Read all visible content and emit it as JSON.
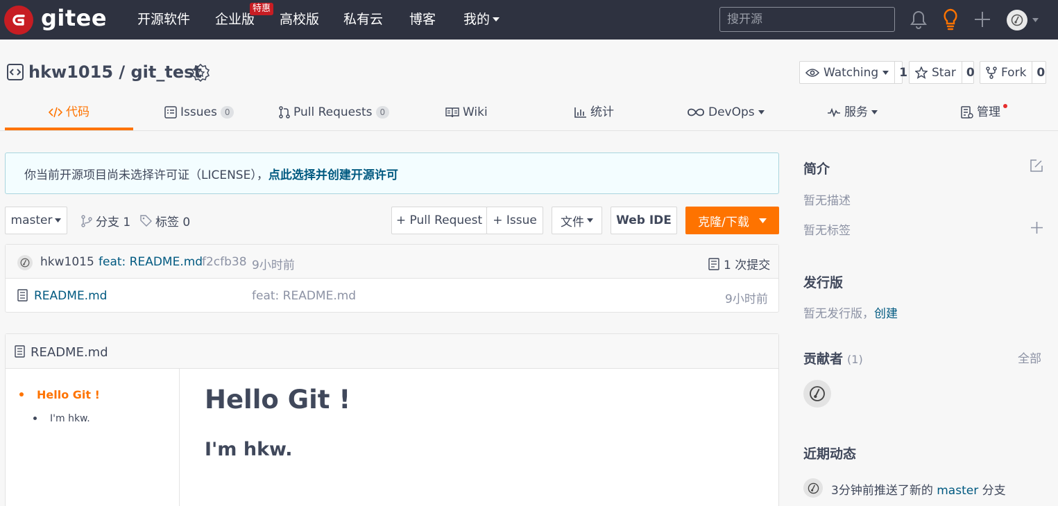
{
  "topnav": {
    "logo_text": "gitee",
    "items": [
      "开源软件",
      "企业版",
      "高校版",
      "私有云",
      "博客",
      "我的"
    ],
    "promo_badge": "特惠",
    "search_placeholder": "搜开源"
  },
  "repo": {
    "owner": "hkw1015",
    "separator": " / ",
    "name": "git_test"
  },
  "counters": {
    "watch_label": "Watching",
    "watch_count": "1",
    "star_label": "Star",
    "star_count": "0",
    "fork_label": "Fork",
    "fork_count": "0"
  },
  "tabs": [
    {
      "label": "代码",
      "icon": "code-icon",
      "active": true
    },
    {
      "label": "Issues",
      "icon": "issues-icon",
      "count": "0"
    },
    {
      "label": "Pull Requests",
      "icon": "pull-request-icon",
      "count": "0"
    },
    {
      "label": "Wiki",
      "icon": "wiki-icon"
    },
    {
      "label": "统计",
      "icon": "stats-icon"
    },
    {
      "label": "DevOps",
      "icon": "devops-icon",
      "dropdown": true
    },
    {
      "label": "服务",
      "icon": "service-icon",
      "dropdown": true
    },
    {
      "label": "管理",
      "icon": "manage-icon",
      "dot": true
    }
  ],
  "notice": {
    "text": "你当前开源项目尚未选择许可证（LICENSE），",
    "link": "点此选择并创建开源许可"
  },
  "toolbar": {
    "branch": "master",
    "branches_label": "分支 1",
    "tags_label": "标签 0",
    "pull_request": "+ Pull Request",
    "issue": "+ Issue",
    "file_menu": "文件",
    "web_ide": "Web IDE",
    "clone": "克隆/下载"
  },
  "commit": {
    "author": "hkw1015",
    "message": "feat: README.md",
    "hash": "f2cfb38",
    "time": "9小时前",
    "commits_count": "1 次提交"
  },
  "files": [
    {
      "name": "README.md",
      "message": "feat: README.md",
      "time": "9小时前"
    }
  ],
  "readme": {
    "filename": "README.md",
    "toc": [
      "Hello Git !",
      "I'm hkw."
    ],
    "h1": "Hello Git !",
    "h2": "I'm hkw."
  },
  "sidebar": {
    "intro_title": "简介",
    "no_description": "暂无描述",
    "no_tags": "暂无标签",
    "release_title": "发行版",
    "no_release": "暂无发行版，",
    "create_link": "创建",
    "contributors_title": "贡献者",
    "contributors_count": "(1)",
    "all_link": "全部",
    "activity_title": "近期动态",
    "activity_prefix": "3分钟前推送了新的 ",
    "activity_branch": "master",
    "activity_suffix": " 分支"
  },
  "colors": {
    "nav_bg": "#2e3240",
    "accent_orange": "#fe7300",
    "brand_red": "#c71d23",
    "link_blue": "#005980"
  }
}
